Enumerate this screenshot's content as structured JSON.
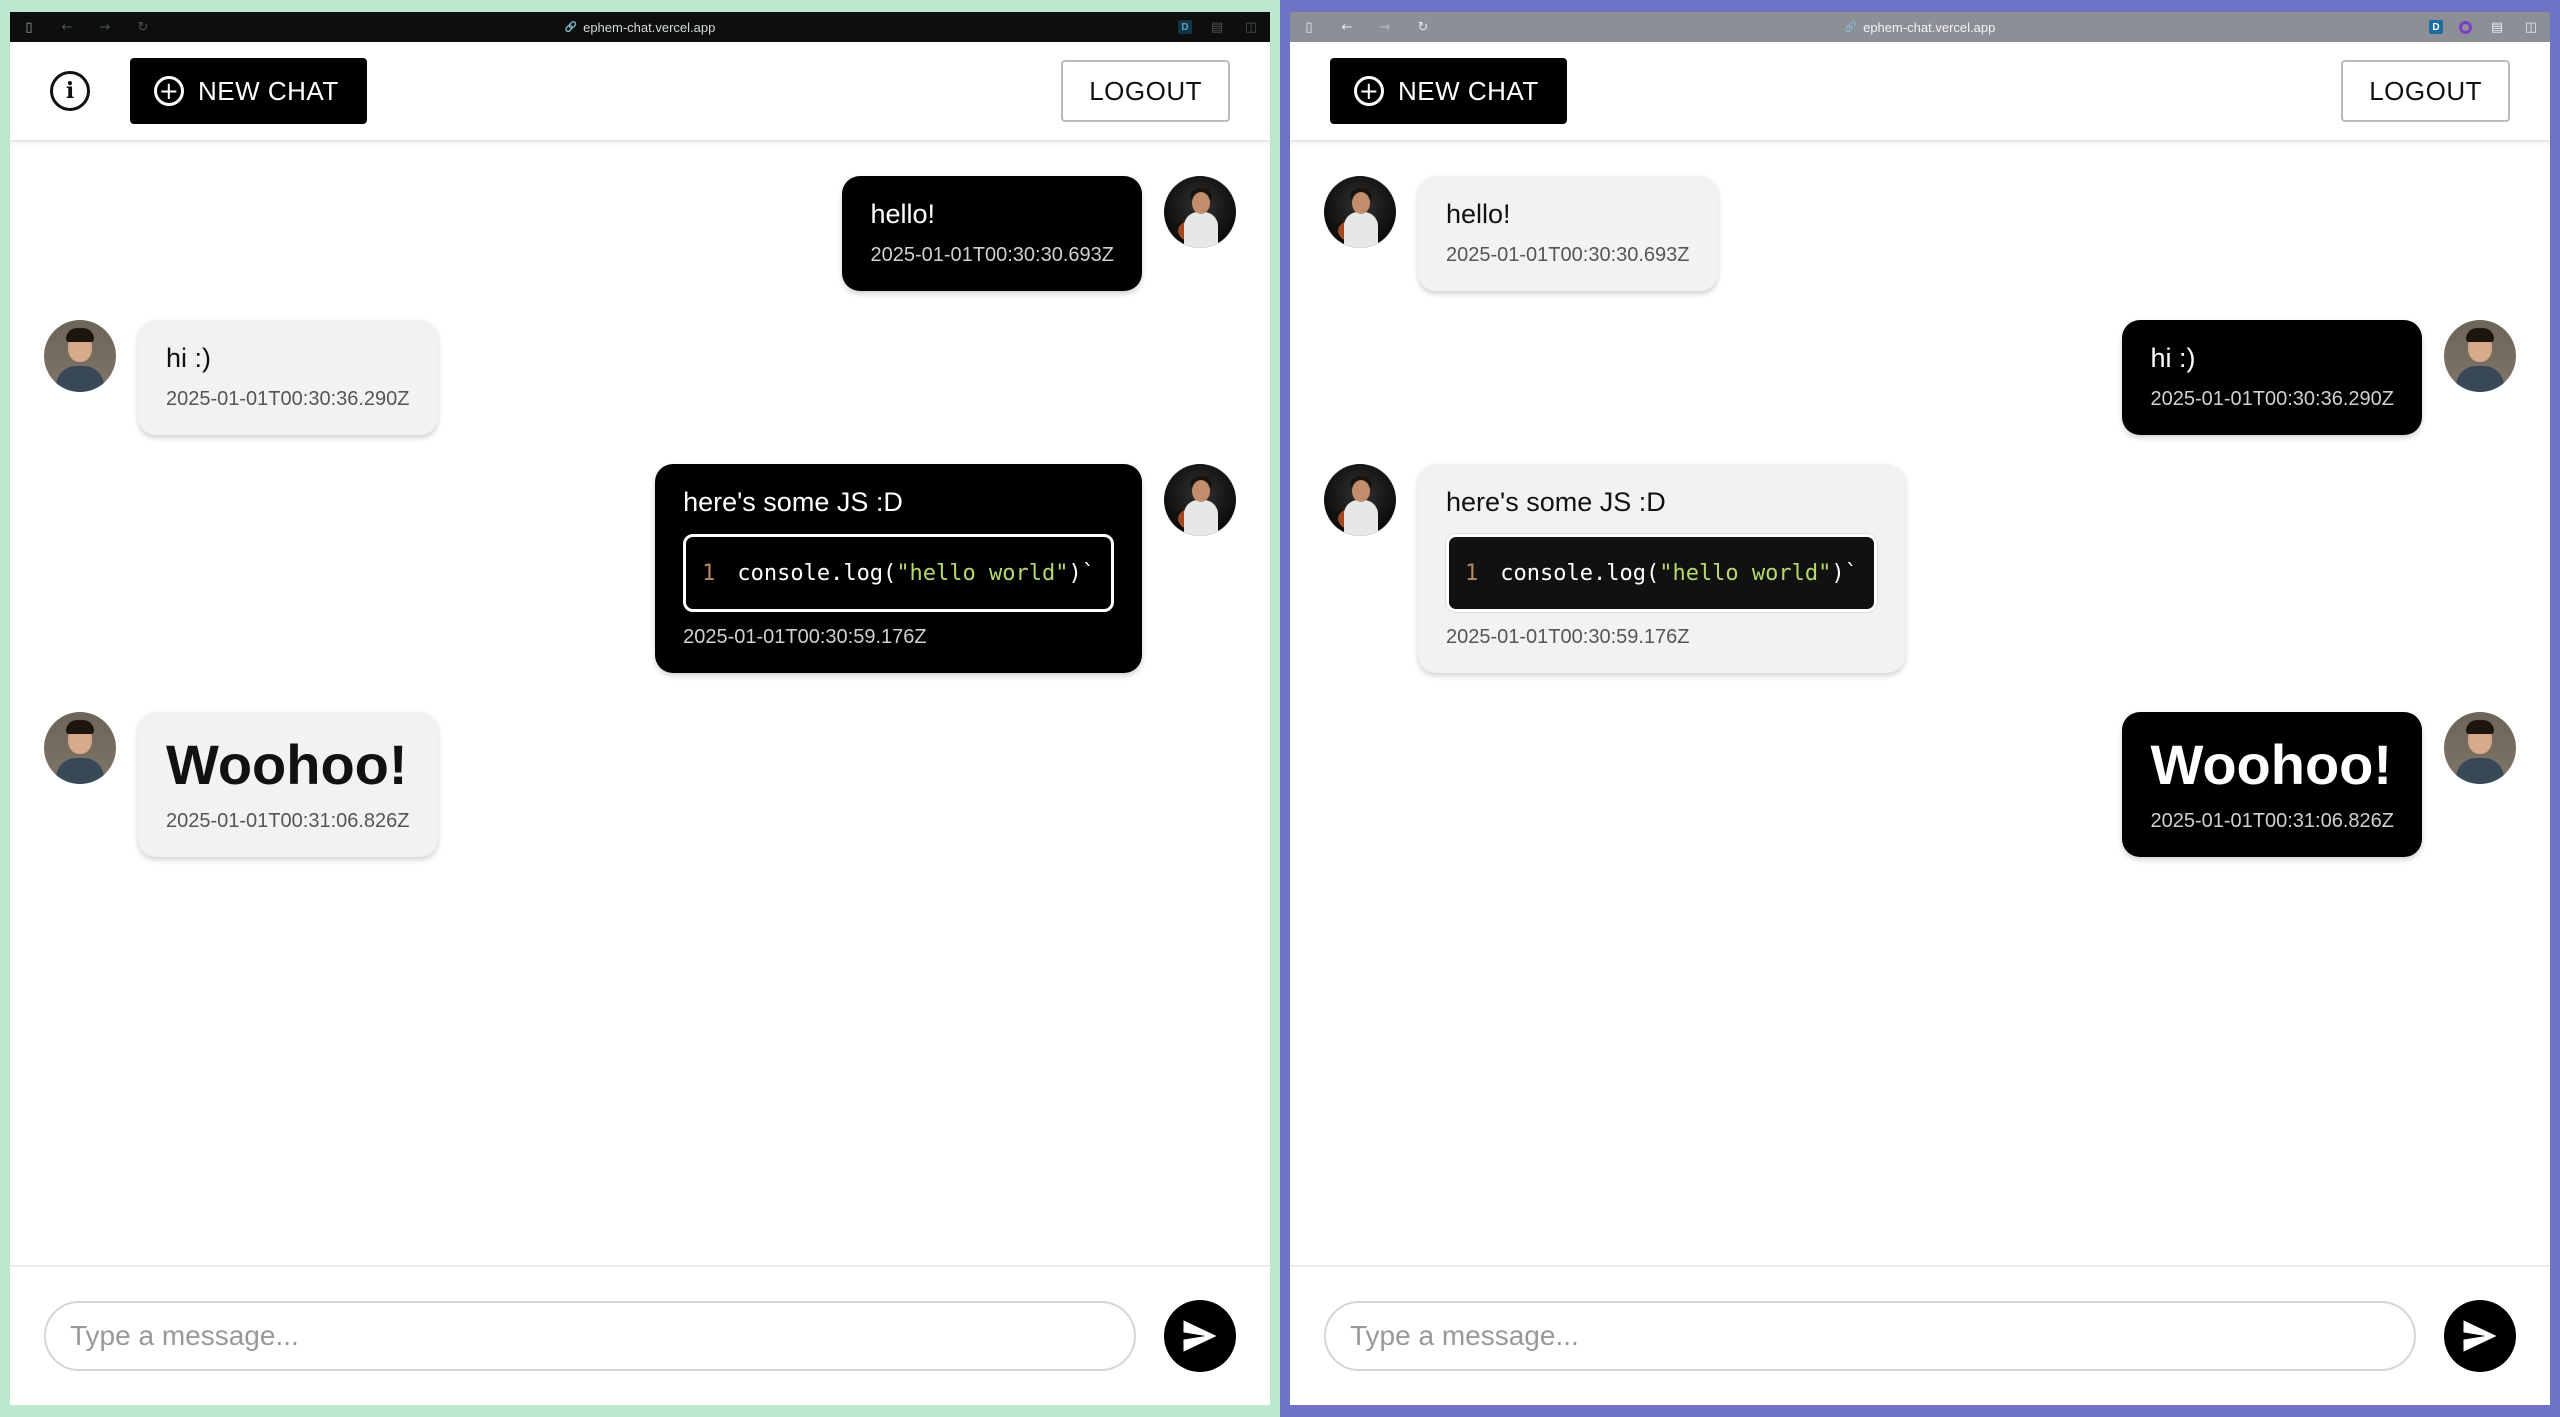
{
  "browser": {
    "url": "ephem-chat.vercel.app",
    "link_icon": "🔗"
  },
  "app": {
    "info_label": "i",
    "new_chat": "NEW CHAT",
    "logout": "LOGOUT",
    "input_placeholder": "Type a message..."
  },
  "code": {
    "line_no": "1",
    "pre": "console.log(",
    "str": "\"hello world\"",
    "post": ")`"
  },
  "messages": [
    {
      "text": "hello!",
      "time": "2025-01-01T00:30:30.693Z"
    },
    {
      "text": "hi :)",
      "time": "2025-01-01T00:30:36.290Z"
    },
    {
      "text": "here's some JS :D",
      "time": "2025-01-01T00:30:59.176Z"
    },
    {
      "text": "Woohoo!",
      "time": "2025-01-01T00:31:06.826Z"
    }
  ],
  "colors": {
    "left_window_border": "#bde8d0",
    "right_window_border": "#6f74c9",
    "own_bubble": "#000000",
    "other_bubble": "#f2f2f2"
  }
}
